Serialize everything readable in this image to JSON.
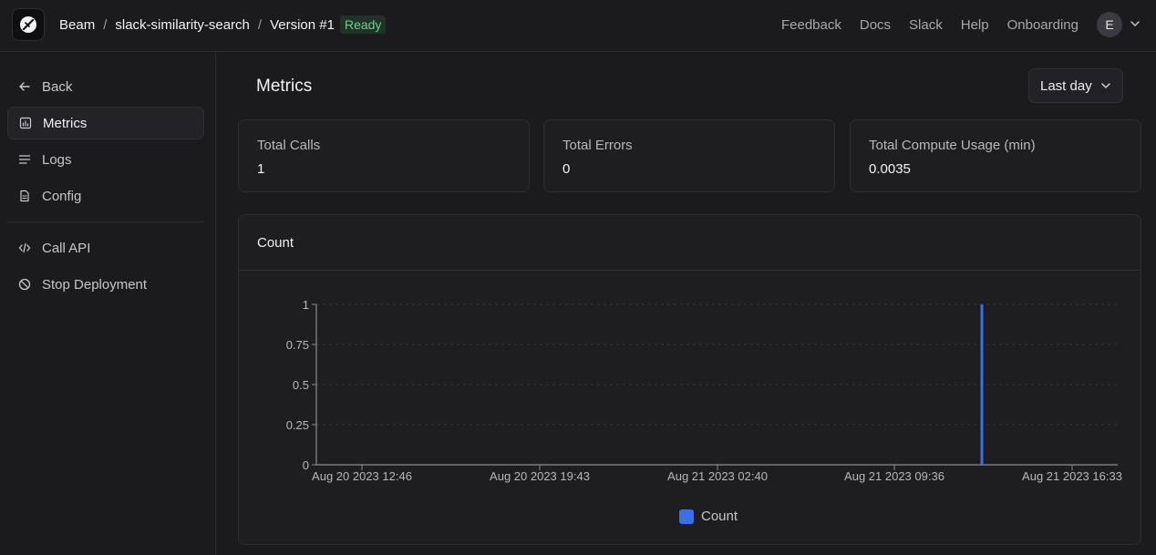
{
  "header": {
    "breadcrumbs": [
      "Beam",
      "slack-similarity-search",
      "Version #1"
    ],
    "status": "Ready",
    "nav": [
      "Feedback",
      "Docs",
      "Slack",
      "Help",
      "Onboarding"
    ],
    "avatar_initial": "E"
  },
  "sidebar": {
    "items": [
      {
        "label": "Back",
        "icon": "arrow-left-icon"
      },
      {
        "label": "Metrics",
        "icon": "chart-icon",
        "active": true
      },
      {
        "label": "Logs",
        "icon": "list-icon"
      },
      {
        "label": "Config",
        "icon": "file-icon"
      },
      {
        "label": "Call API",
        "icon": "code-icon"
      },
      {
        "label": "Stop Deployment",
        "icon": "ban-icon"
      }
    ]
  },
  "main": {
    "title": "Metrics",
    "range": "Last day",
    "stats": [
      {
        "label": "Total Calls",
        "value": "1"
      },
      {
        "label": "Total Errors",
        "value": "0"
      },
      {
        "label": "Total Compute Usage (min)",
        "value": "0.0035"
      }
    ]
  },
  "colors": {
    "accent": "#3b6fe8",
    "ready": "#6fcf8e"
  },
  "chart_data": {
    "type": "bar",
    "title": "Count",
    "series": [
      {
        "name": "Count",
        "values": [
          1
        ]
      }
    ],
    "x": [
      "Aug 21 2023 12:27"
    ],
    "x_ticks": [
      "Aug 20 2023 12:46",
      "Aug 20 2023 19:43",
      "Aug 21 2023 02:40",
      "Aug 21 2023 09:36",
      "Aug 21 2023 16:33"
    ],
    "y_ticks": [
      "0",
      "0.25",
      "0.5",
      "0.75",
      "1"
    ],
    "ylim": [
      0,
      1
    ],
    "grid": true,
    "legend": "bottom"
  }
}
